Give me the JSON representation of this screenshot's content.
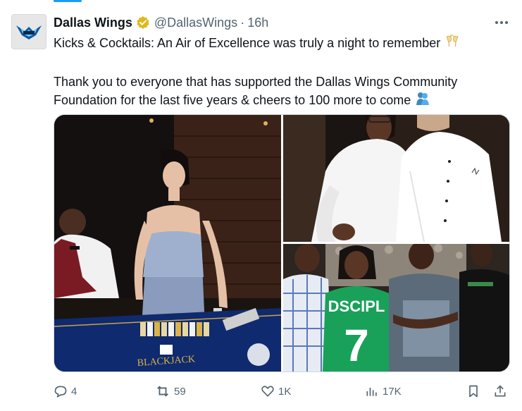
{
  "tweet": {
    "author_name": "Dallas Wings",
    "handle": "@DallasWings",
    "separator": "·",
    "time": "16h",
    "text_line1": "Kicks & Cocktails: An Air of Excellence was truly a night to remember",
    "text_line2": "Thank you to everyone that has supported the Dallas Wings Community Foundation for the last five years & cheers to 100 more to come",
    "emoji1": "clinking-glasses-icon",
    "emoji2": "hugging-people-icon"
  },
  "photos": [
    {
      "jersey_text": "DSCIPL",
      "jersey_number": "7"
    }
  ],
  "metrics": {
    "replies": "4",
    "reposts": "59",
    "likes": "1K",
    "views": "17K"
  },
  "colors": {
    "accent": "#1d9bf0",
    "verified_gold": "#e2b719",
    "secondary_text": "#536471",
    "border": "#cfd9de"
  }
}
